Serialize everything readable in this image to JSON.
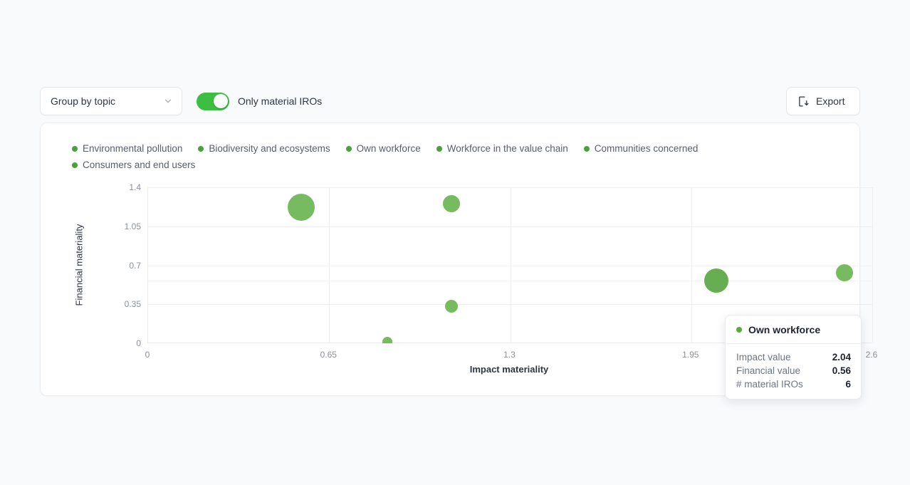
{
  "toolbar": {
    "group_by_label": "Group by topic",
    "chevron_icon": "chevron-down-icon",
    "toggle_label": "Only material IROs",
    "toggle_on": true,
    "export_label": "Export",
    "export_icon": "export-download-icon"
  },
  "colors": {
    "page_background": "#f8fafc",
    "card_background": "#ffffff",
    "toggle_on": "#3cbf40",
    "bubble": "#77bb61",
    "bubble_hover": "#66ae51",
    "legend_dot": "#4ba03b",
    "grid": "#eceef0",
    "axis": "#e9ebee",
    "text_primary": "#2f3640",
    "text_muted": "#8a9099"
  },
  "tooltip": {
    "title": "Own workforce",
    "dot_icon": "legend-dot-icon",
    "rows": [
      {
        "key": "Impact value",
        "value": "2.04"
      },
      {
        "key": "Financial value",
        "value": "0.56"
      },
      {
        "key": "# material IROs",
        "value": "6"
      }
    ]
  },
  "chart_data": {
    "type": "scatter",
    "title": "",
    "xlabel": "Impact materiality",
    "ylabel": "Financial materiality",
    "xlim": [
      0,
      2.6
    ],
    "ylim": [
      0,
      1.4
    ],
    "xticks": [
      "0",
      "0.65",
      "1.3",
      "1.95",
      "2.6"
    ],
    "xtick_values": [
      0,
      0.65,
      1.3,
      1.95,
      2.6
    ],
    "yticks": [
      "0",
      "0.35",
      "0.7",
      "1.05",
      "1.4"
    ],
    "ytick_values": [
      0,
      0.35,
      0.7,
      1.05,
      1.4
    ],
    "grid": true,
    "legend_position": "top-left",
    "legend": [
      "Environmental pollution",
      "Biodiversity and ecosystems",
      "Own workforce",
      "Workforce in the value chain",
      "Communities concerned",
      "Consumers and end users"
    ],
    "points": [
      {
        "name": "Environmental pollution",
        "x": 0.55,
        "y": 1.22,
        "size": 6,
        "r": 19,
        "active": false
      },
      {
        "name": "Biodiversity and ecosystems",
        "x": 1.09,
        "y": 1.25,
        "size": 3,
        "r": 12,
        "active": false
      },
      {
        "name": "Own workforce",
        "x": 2.04,
        "y": 0.56,
        "size": 6,
        "r": 17,
        "active": true
      },
      {
        "name": "Workforce in the value chain",
        "x": 2.5,
        "y": 0.63,
        "size": 3,
        "r": 12,
        "active": false
      },
      {
        "name": "Communities concerned",
        "x": 1.09,
        "y": 0.33,
        "size": 2,
        "r": 9,
        "active": false
      },
      {
        "name": "Consumers and end users",
        "x": 0.86,
        "y": 0.01,
        "size": 1,
        "r": 7,
        "active": false
      }
    ]
  }
}
